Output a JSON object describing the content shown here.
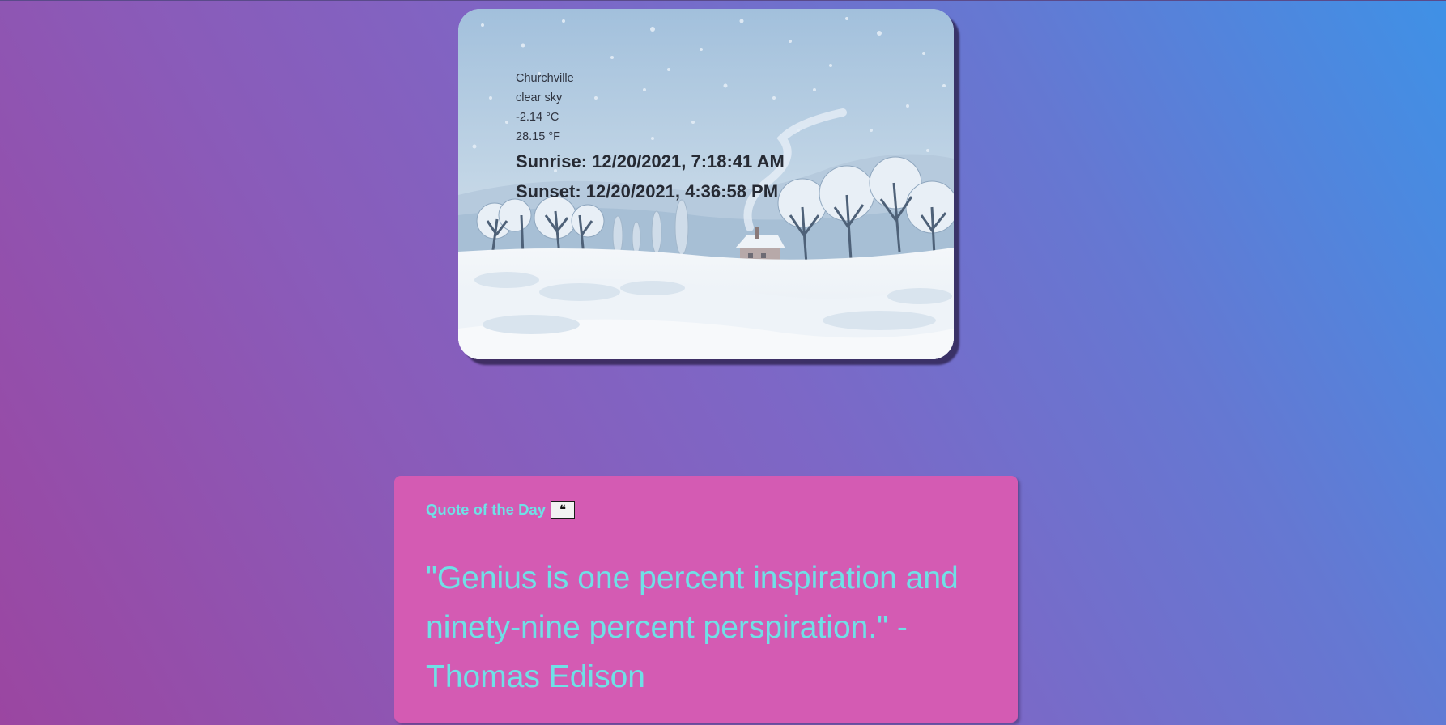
{
  "weather": {
    "city": "Churchville",
    "description": "clear sky",
    "temp_c": "-2.14 °C",
    "temp_f": "28.15 °F",
    "sunrise": "Sunrise: 12/20/2021, 7:18:41 AM",
    "sunset": "Sunset: 12/20/2021, 4:36:58 PM",
    "background_icon": "snowy-landscape-illustration"
  },
  "quote": {
    "title": "Quote of the Day",
    "button_glyph": "❝",
    "button_icon": "quote-icon",
    "text": "\"Genius is one percent inspiration and ninety-nine percent perspiration.\" - Thomas Edison"
  },
  "colors": {
    "quote_card_bg": "#d45bb3",
    "quote_text": "#6fe0e6",
    "gradient_start": "#9b46a1",
    "gradient_end": "#3f91e6"
  }
}
